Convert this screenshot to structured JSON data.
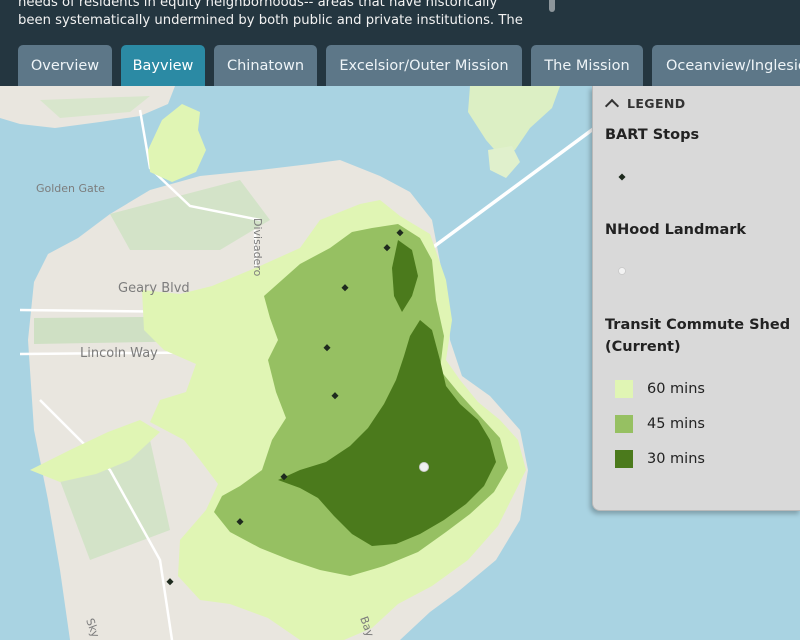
{
  "header": {
    "intro_lines": [
      "needs of residents in equity neighborhoods-- areas that have historically",
      "been systematically undermined by both public and private institutions. The"
    ]
  },
  "tabs": [
    {
      "label": "Overview",
      "active": false
    },
    {
      "label": "Bayview",
      "active": true
    },
    {
      "label": "Chinatown",
      "active": false
    },
    {
      "label": "Excelsior/Outer Mission",
      "active": false
    },
    {
      "label": "The Mission",
      "active": false
    },
    {
      "label": "Oceanview/Inglesio",
      "active": false
    }
  ],
  "map": {
    "labels": {
      "golden_gate": "Golden Gate",
      "geary": "Geary Blvd",
      "lincoln": "Lincoln Way",
      "divisadero": "Divisadero",
      "sky": "Sky",
      "bay": "Bay"
    },
    "colors": {
      "water": "#a9d3e2",
      "land": "#e9e6df",
      "park": "#cfe0c4",
      "shed_60": "#e0f5b4",
      "shed_45": "#96c062",
      "shed_30": "#4b7a1c"
    }
  },
  "legend": {
    "header": "LEGEND",
    "bart": {
      "title": "BART Stops",
      "icon": "black-diamond"
    },
    "landmark": {
      "title": "NHood Landmark",
      "icon": "white-dot"
    },
    "shed": {
      "title_line1": "Transit Commute Shed",
      "title_line2": "(Current)",
      "items": [
        {
          "label": "60 mins",
          "color": "#e0f5b4"
        },
        {
          "label": "45 mins",
          "color": "#96c062"
        },
        {
          "label": "30 mins",
          "color": "#4b7a1c"
        }
      ]
    }
  }
}
